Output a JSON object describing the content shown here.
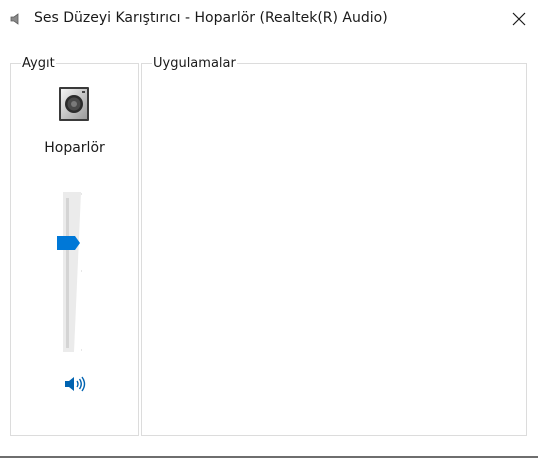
{
  "window": {
    "title": "Ses Düzeyi Karıştırıcı - Hoparlör (Realtek(R) Audio)"
  },
  "device_section": {
    "label": "Aygıt",
    "device_name": "Hoparlör",
    "device_icon": "speaker-device-icon",
    "volume_level": 0.68,
    "mute_icon": "speaker-volume-icon"
  },
  "apps_section": {
    "label": "Uygulamalar"
  },
  "colors": {
    "accent": "#0078d7",
    "group_border": "#dcdcdc"
  }
}
